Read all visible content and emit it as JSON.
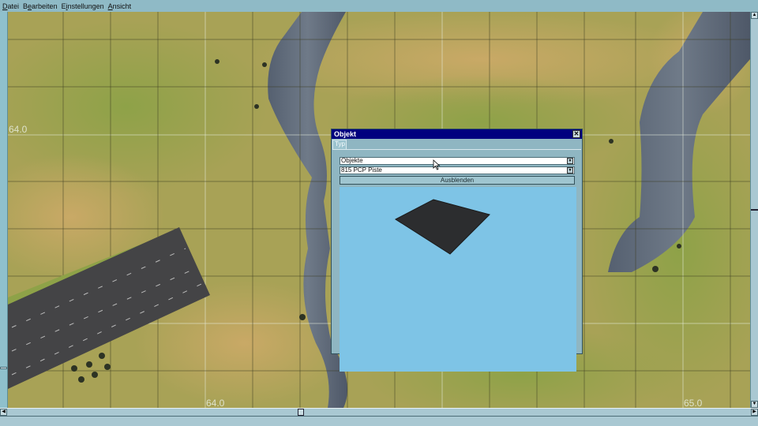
{
  "menu": {
    "items": [
      {
        "label": "Datei",
        "accel": "D"
      },
      {
        "label": "Bearbeiten",
        "accel": "e"
      },
      {
        "label": "Einstellungen",
        "accel": "i"
      },
      {
        "label": "Ansicht",
        "accel": "A"
      }
    ]
  },
  "map": {
    "coords": {
      "left_y": "64.0",
      "bottom_x1": "64.0",
      "bottom_x2": "65.0"
    }
  },
  "dialog": {
    "title": "Objekt",
    "close_icon": "close-icon",
    "tab": "Typ",
    "category_select": "Objekte",
    "object_select": "815 PCP Piste",
    "hide_button": "Ausblenden"
  }
}
